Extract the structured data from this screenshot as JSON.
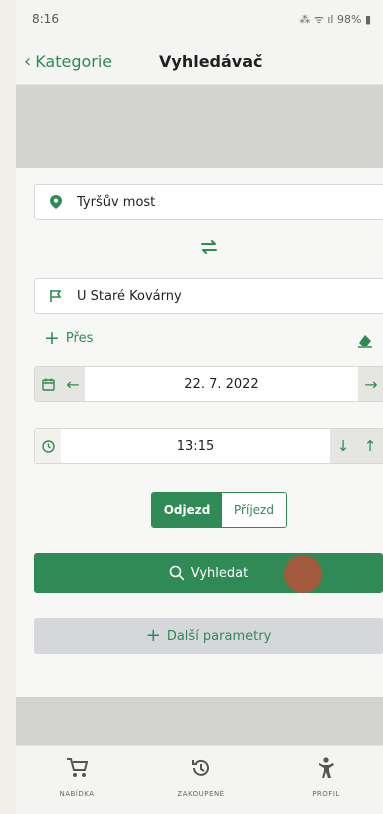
{
  "status_bar": {
    "time": "8:16",
    "battery": "98%"
  },
  "header": {
    "back_label": "Kategorie",
    "title": "Vyhledávač"
  },
  "form": {
    "from": "Tyršův most",
    "to": "U Staré Kovárny",
    "via_label": "Přes",
    "date": "22. 7. 2022",
    "time": "13:15",
    "departure_label": "Odjezd",
    "arrival_label": "Příjezd",
    "search_label": "Vyhledat",
    "more_params_label": "Další parametry"
  },
  "tabbar": {
    "items": [
      {
        "label": "NABÍDKA",
        "icon": "cart-icon"
      },
      {
        "label": "ZAKOUPENÉ",
        "icon": "history-icon"
      },
      {
        "label": "PROFIL",
        "icon": "person-icon"
      }
    ]
  },
  "colors": {
    "accent": "#2f8a55",
    "gray_band": "#d3d3cf",
    "params_bg": "#d6d7db"
  }
}
